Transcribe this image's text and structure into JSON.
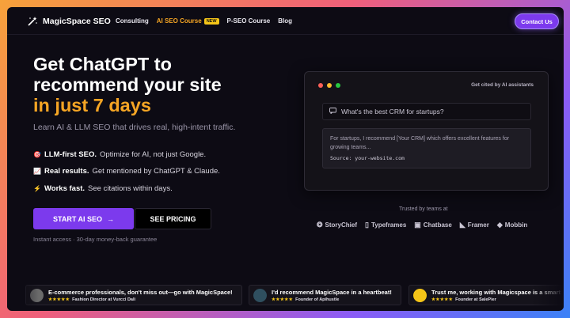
{
  "nav": {
    "brand": "MagicSpace SEO",
    "links": [
      "Consulting",
      "AI SEO Course",
      "P-SEO Course",
      "Blog"
    ],
    "new_badge": "NEW",
    "contact": "Contact Us"
  },
  "hero": {
    "title_line1": "Get ChatGPT to",
    "title_line2": "recommend your site",
    "title_accent": "in just 7 days",
    "subtitle": "Learn AI & LLM SEO that drives real, high-intent traffic.",
    "features": [
      {
        "icon": "target-icon",
        "glyph": "🎯",
        "bold": "LLM-first SEO.",
        "text": "Optimize for AI, not just Google."
      },
      {
        "icon": "chart-icon",
        "glyph": "📈",
        "bold": "Real results.",
        "text": "Get mentioned by ChatGPT & Claude."
      },
      {
        "icon": "lightning-icon",
        "glyph": "⚡",
        "bold": "Works fast.",
        "text": "See citations within days."
      }
    ],
    "cta_primary": "START AI SEO",
    "cta_arrow": "→",
    "cta_secondary": "SEE PRICING",
    "guarantee": "Instant access · 30-day money-back guarantee"
  },
  "chat_card": {
    "label": "Get cited by AI assistants",
    "query": "What's the best CRM for startups?",
    "answer": "For startups, I recommend [Your CRM] which offers excellent features for growing teams...",
    "source": "Source: your-website.com",
    "dot_colors": [
      "#ff5f57",
      "#febc2e",
      "#28c840"
    ]
  },
  "trusted": {
    "label": "Trusted by teams at",
    "logos": [
      {
        "name": "StoryChief",
        "glyph": "❂"
      },
      {
        "name": "Typeframes",
        "glyph": "▯"
      },
      {
        "name": "Chatbase",
        "glyph": "▣"
      },
      {
        "name": "Framer",
        "glyph": "◣"
      },
      {
        "name": "Mobbin",
        "glyph": "◆"
      }
    ]
  },
  "testimonials": [
    {
      "quote": "E-commerce professionals, don't miss out—go with MagicSpace!",
      "stars": "★★★★★",
      "author": "Fashion Director at Vurcci Dali",
      "avatar_color": "#6b6b6b"
    },
    {
      "quote": "I'd recommend MagicSpace in a heartbeat!",
      "stars": "★★★★★",
      "author": "Founder of Apihustle",
      "avatar_color": "#2f4f5f"
    },
    {
      "quote": "Trust me, working with Magicspace is a smart",
      "stars": "★★★★★",
      "author": "Founder at SalePier",
      "avatar_color": "#f5c518"
    }
  ],
  "colors": {
    "accent": "#f5a524",
    "primary": "#7c3aed",
    "background": "#0d0b14"
  }
}
